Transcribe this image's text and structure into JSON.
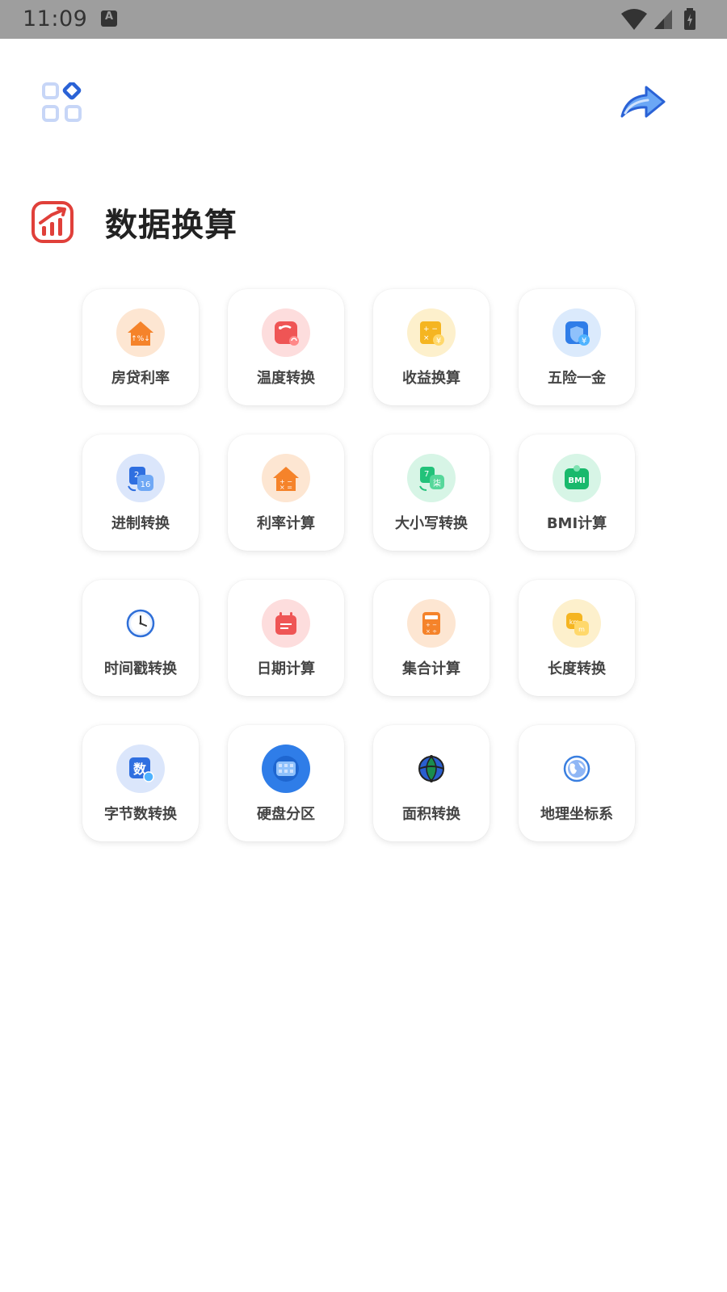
{
  "status_bar": {
    "time": "11:09",
    "notification_letter": "A"
  },
  "section": {
    "title": "数据换算"
  },
  "tools": [
    {
      "label": "房贷利率",
      "icon": "house-percent-icon",
      "bg": "#fde6d2",
      "color": "#f5832a"
    },
    {
      "label": "温度转换",
      "icon": "thermometer-icon",
      "bg": "#fddddd",
      "color": "#ef5555"
    },
    {
      "label": "收益换算",
      "icon": "calculator-yuan-icon",
      "bg": "#fdf0cc",
      "color": "#f5b521"
    },
    {
      "label": "五险一金",
      "icon": "shield-yuan-icon",
      "bg": "#dbeafc",
      "color": "#2f7de8"
    },
    {
      "label": "进制转换",
      "icon": "number-base-icon",
      "bg": "#dbe6fb",
      "color": "#2f6fe0"
    },
    {
      "label": "利率计算",
      "icon": "house-calculator-icon",
      "bg": "#fde6d2",
      "color": "#f5832a"
    },
    {
      "label": "大小写转换",
      "icon": "number-case-icon",
      "bg": "#d7f5e6",
      "color": "#22c27a"
    },
    {
      "label": "BMI计算",
      "icon": "bmi-scale-icon",
      "bg": "#d7f5e6",
      "color": "#19b96c",
      "text": "BMI"
    },
    {
      "label": "时间戳转换",
      "icon": "clock-icon",
      "bg": "#ffffff",
      "color": "#2f6fd8"
    },
    {
      "label": "日期计算",
      "icon": "calendar-icon",
      "bg": "#fddddd",
      "color": "#ef5555"
    },
    {
      "label": "集合计算",
      "icon": "calculator-icon",
      "bg": "#fde6d2",
      "color": "#f5832a"
    },
    {
      "label": "长度转换",
      "icon": "ruler-km-icon",
      "bg": "#fdf0cc",
      "color": "#f5b521"
    },
    {
      "label": "字节数转换",
      "icon": "byte-count-icon",
      "bg": "#dbe6fb",
      "color": "#2f6fe0",
      "text": "数"
    },
    {
      "label": "硬盘分区",
      "icon": "disk-partition-icon",
      "bg": "#2f7de8",
      "color": "#5aa3f5"
    },
    {
      "label": "面积转换",
      "icon": "globe-leaf-icon",
      "bg": "#ffffff",
      "color": "#1a8d4e"
    },
    {
      "label": "地理坐标系",
      "icon": "earth-icon",
      "bg": "#ffffff",
      "color": "#3a7fe0"
    }
  ]
}
